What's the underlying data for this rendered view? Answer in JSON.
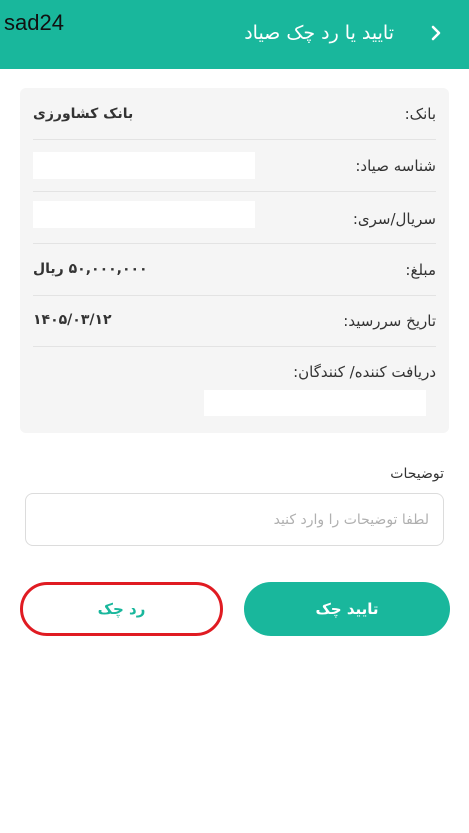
{
  "header": {
    "watermark": "sad24",
    "title": "تایید یا رد چک صیاد",
    "back_icon": "chevron-right-icon"
  },
  "details": {
    "bank": {
      "label": "بانک:",
      "value": "بانک کشاورزی"
    },
    "sayad_id": {
      "label": "شناسه صیاد:"
    },
    "serial": {
      "label": "سریال/سری:"
    },
    "amount": {
      "label": "مبلغ:",
      "value": "۵۰,۰۰۰,۰۰۰ ریال"
    },
    "due_date": {
      "label": "تاریخ سررسید:",
      "value": "۱۴۰۵/۰۳/۱۲"
    },
    "receivers": {
      "label": "دریافت کننده/ کنندگان:"
    }
  },
  "notes": {
    "label": "توضیحات",
    "placeholder": "لطفا توضیحات را وارد کنید",
    "value": ""
  },
  "actions": {
    "confirm_label": "تایید چک",
    "reject_label": "رد چک"
  },
  "colors": {
    "brand": "#19b79c",
    "highlight": "#e01b22"
  }
}
